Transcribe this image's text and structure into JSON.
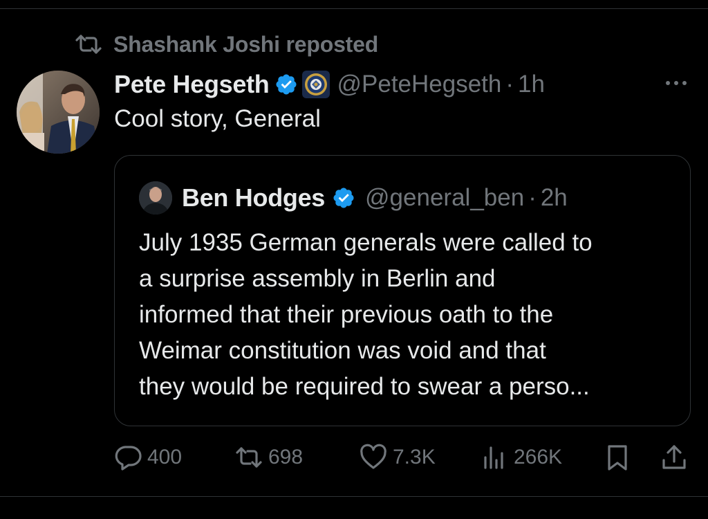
{
  "repost": {
    "text": "Shashank Joshi reposted",
    "icon": "repost-icon"
  },
  "tweet": {
    "display_name": "Pete Hegseth",
    "handle": "@PeteHegseth",
    "separator": "·",
    "time": "1h",
    "text": "Cool story, General",
    "more_icon": "more-icon"
  },
  "quote": {
    "display_name": "Ben Hodges",
    "handle": "@general_ben",
    "separator": "·",
    "time": "2h",
    "lines": [
      "July 1935 German generals were called to",
      "a surprise assembly in Berlin and",
      "informed that their previous oath to the",
      "Weimar constitution was void and that",
      "they would be required to swear a perso..."
    ]
  },
  "actions": {
    "replies": "400",
    "reposts": "698",
    "likes": "7.3K",
    "views": "266K"
  },
  "colors": {
    "background": "#000000",
    "text": "#e7e9ea",
    "muted": "#71767b",
    "verified": "#1d9bf0",
    "border": "#2f3336"
  }
}
